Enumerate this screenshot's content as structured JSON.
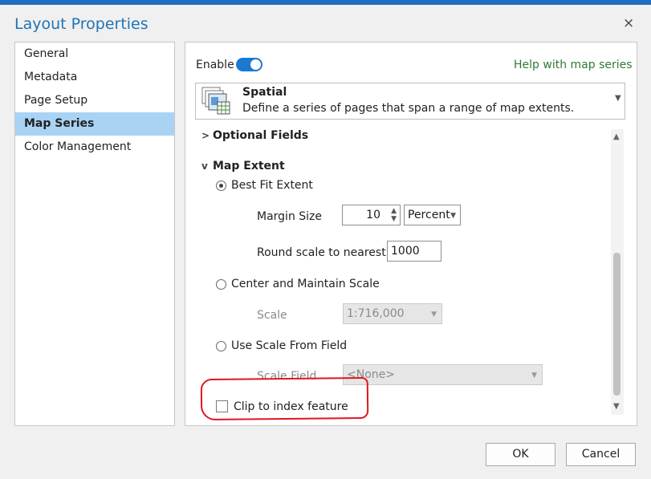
{
  "dialog": {
    "title": "Layout Properties",
    "close_glyph": "×"
  },
  "sidebar": {
    "items": [
      {
        "label": "General"
      },
      {
        "label": "Metadata"
      },
      {
        "label": "Page Setup"
      },
      {
        "label": "Map Series",
        "selected": true
      },
      {
        "label": "Color Management"
      }
    ]
  },
  "header": {
    "enable_label": "Enable",
    "enabled": true,
    "help_link": "Help with map series"
  },
  "series_type": {
    "title": "Spatial",
    "description": "Define a series of pages that span a range of map extents."
  },
  "optional_fields": {
    "label": "Optional Fields",
    "expanded": false
  },
  "map_extent": {
    "label": "Map Extent",
    "expanded": true,
    "best_fit": {
      "label": "Best Fit Extent",
      "selected": true,
      "margin_size_label": "Margin Size",
      "margin_size_value": "10",
      "margin_unit": "Percent",
      "round_scale_label": "Round scale to nearest",
      "round_scale_value": "1000"
    },
    "center_maintain": {
      "label": "Center and Maintain Scale",
      "selected": false,
      "scale_label": "Scale",
      "scale_value": "1:716,000"
    },
    "scale_from_field": {
      "label": "Use Scale From Field",
      "selected": false,
      "field_label": "Scale Field",
      "field_value": "<None>"
    }
  },
  "clip": {
    "label": "Clip to index feature",
    "checked": false
  },
  "buttons": {
    "ok": "OK",
    "cancel": "Cancel"
  },
  "colors": {
    "accent": "#1b79d0",
    "selection": "#a9d3f5",
    "help_link": "#2f7a33",
    "annotation": "#e0171e"
  }
}
